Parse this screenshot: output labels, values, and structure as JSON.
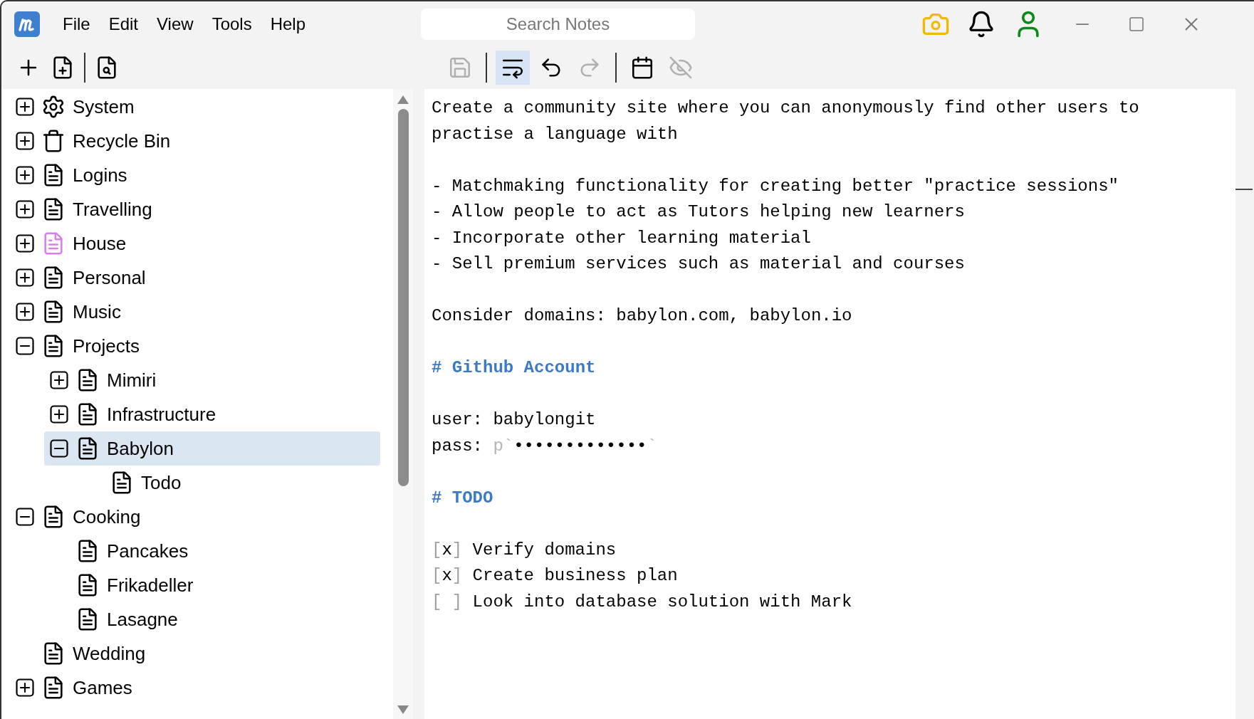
{
  "menu": [
    "File",
    "Edit",
    "View",
    "Tools",
    "Help"
  ],
  "search": {
    "placeholder": "Search Notes"
  },
  "toolbar_left": [
    {
      "kind": "add",
      "disabled": false
    },
    {
      "kind": "new-note",
      "disabled": false
    },
    {
      "kind": "divider"
    },
    {
      "kind": "find-note",
      "disabled": false
    }
  ],
  "toolbar_editor": [
    {
      "kind": "save",
      "disabled": true,
      "selected": false
    },
    {
      "kind": "divider"
    },
    {
      "kind": "wrap",
      "disabled": false,
      "selected": true
    },
    {
      "kind": "undo",
      "disabled": false,
      "selected": false
    },
    {
      "kind": "redo",
      "disabled": true,
      "selected": false
    },
    {
      "kind": "divider"
    },
    {
      "kind": "calendar",
      "disabled": false,
      "selected": false
    },
    {
      "kind": "hide",
      "disabled": true,
      "selected": false
    }
  ],
  "tree": [
    {
      "label": "System",
      "kind": "gear",
      "color": "#000000",
      "expanded": false,
      "selected": false
    },
    {
      "label": "Recycle Bin",
      "kind": "trash",
      "color": "#000000",
      "expanded": false,
      "selected": false
    },
    {
      "label": "Logins",
      "kind": "note",
      "color": "#000000",
      "expanded": false,
      "selected": false
    },
    {
      "label": "Travelling",
      "kind": "note",
      "color": "#000000",
      "expanded": false,
      "selected": false
    },
    {
      "label": "House",
      "kind": "note",
      "color": "#d77ff0",
      "expanded": false,
      "selected": false
    },
    {
      "label": "Personal",
      "kind": "note",
      "color": "#000000",
      "expanded": false,
      "selected": false
    },
    {
      "label": "Music",
      "kind": "note",
      "color": "#000000",
      "expanded": false,
      "selected": false
    },
    {
      "label": "Projects",
      "kind": "note",
      "color": "#000000",
      "expanded": true,
      "selected": false,
      "children": [
        {
          "label": "Mimiri",
          "kind": "note",
          "color": "#000000",
          "expanded": false,
          "selected": false
        },
        {
          "label": "Infrastructure",
          "kind": "note",
          "color": "#000000",
          "expanded": false,
          "selected": false
        },
        {
          "label": "Babylon",
          "kind": "note",
          "color": "#000000",
          "expanded": true,
          "selected": true,
          "children": [
            {
              "label": "Todo",
              "kind": "note",
              "color": "#000000",
              "selected": false
            }
          ]
        }
      ]
    },
    {
      "label": "Cooking",
      "kind": "note",
      "color": "#000000",
      "expanded": true,
      "selected": false,
      "children": [
        {
          "label": "Pancakes",
          "kind": "note",
          "color": "#000000",
          "selected": false
        },
        {
          "label": "Frikadeller",
          "kind": "note",
          "color": "#000000",
          "selected": false
        },
        {
          "label": "Lasagne",
          "kind": "note",
          "color": "#000000",
          "selected": false
        }
      ]
    },
    {
      "label": "Wedding",
      "kind": "note",
      "color": "#000000",
      "selected": false
    },
    {
      "label": "Games",
      "kind": "note",
      "color": "#000000",
      "expanded": false,
      "selected": false
    }
  ],
  "editor": [
    {
      "kind": "text",
      "text": "Create a community site where you can anonymously find other users to practise a language with"
    },
    {
      "kind": "blank"
    },
    {
      "kind": "text",
      "text": "- Matchmaking functionality for creating better \"practice sessions\""
    },
    {
      "kind": "text",
      "text": "- Allow people to act as Tutors helping new learners"
    },
    {
      "kind": "text",
      "text": "- Incorporate other learning material"
    },
    {
      "kind": "text",
      "text": "- Sell premium services such as material and courses"
    },
    {
      "kind": "blank"
    },
    {
      "kind": "text",
      "text": "Consider domains: babylon.com, babylon.io"
    },
    {
      "kind": "blank"
    },
    {
      "kind": "heading",
      "text": "# Github Account"
    },
    {
      "kind": "blank"
    },
    {
      "kind": "text",
      "text": "user: babylongit"
    },
    {
      "kind": "password",
      "label": "pass:",
      "prefix": "p`",
      "mask": "•••••••••••••",
      "suffix": "`"
    },
    {
      "kind": "blank"
    },
    {
      "kind": "heading",
      "text": "# TODO"
    },
    {
      "kind": "blank"
    },
    {
      "kind": "todo",
      "open": "[",
      "close": "]",
      "checked": true,
      "mark": "x",
      "text": "Verify domains"
    },
    {
      "kind": "todo",
      "open": "[",
      "close": "]",
      "checked": true,
      "mark": "x",
      "text": "Create business plan"
    },
    {
      "kind": "todo",
      "open": "[",
      "close": "]",
      "checked": false,
      "text": "Look into database solution with Mark"
    }
  ]
}
